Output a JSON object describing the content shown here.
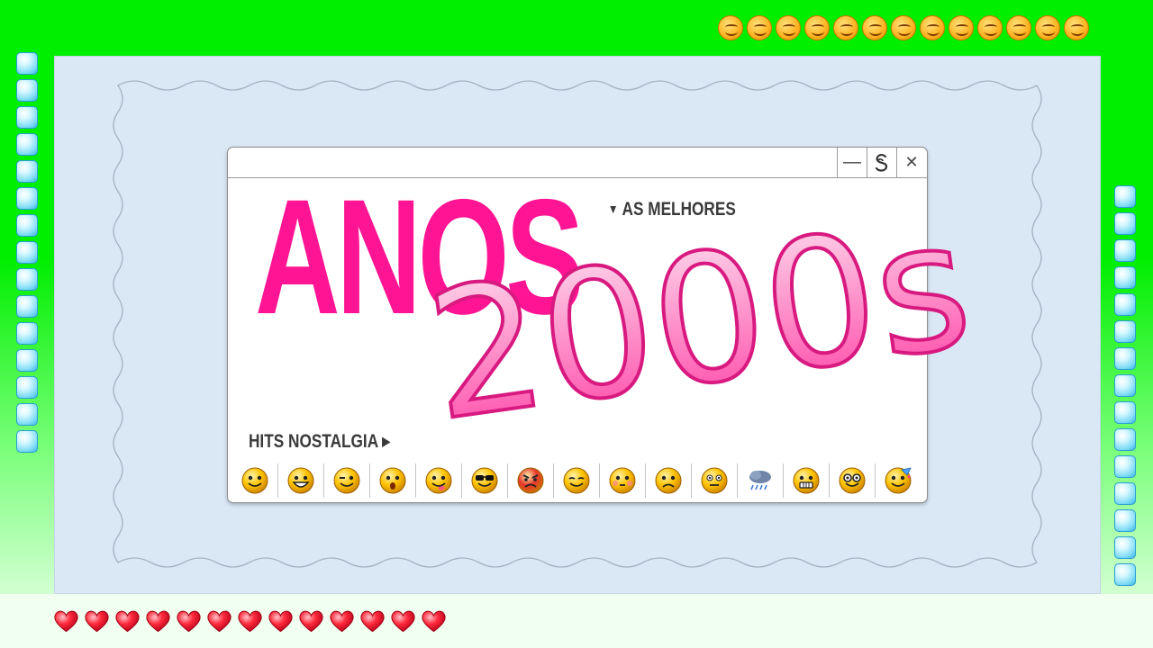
{
  "headline": {
    "word": "ANOS",
    "decade": "2000s"
  },
  "taglines": {
    "top": "AS MELHORES",
    "bottom": "HITS NOSTALGIA"
  },
  "window_controls": {
    "minimize": "—",
    "middle": "S",
    "close": "✕"
  },
  "colors": {
    "background_green": "#00ee00",
    "panel": "#dae8f6",
    "headline_pink": "#ff1493",
    "decade_gradient": [
      "#fde3f1",
      "#ff3fa4"
    ],
    "tile_blue": "#7fdcf6",
    "heart_red": "#ff2a3c"
  },
  "emoticons": [
    {
      "icon": "smile",
      "color": "#ffc400"
    },
    {
      "icon": "grin",
      "color": "#ffc400"
    },
    {
      "icon": "wink",
      "color": "#ffc400"
    },
    {
      "icon": "surprised",
      "color": "#ffc400"
    },
    {
      "icon": "tongue-out",
      "color": "#ffc400"
    },
    {
      "icon": "sunglasses",
      "color": "#ffc400"
    },
    {
      "icon": "angry",
      "color": "#e8352a"
    },
    {
      "icon": "sleepy",
      "color": "#ffc400"
    },
    {
      "icon": "blush",
      "color": "#ffc400"
    },
    {
      "icon": "sad",
      "color": "#ffc400"
    },
    {
      "icon": "neutral",
      "color": "#ffc400"
    },
    {
      "icon": "rain-cloud",
      "color": "#6f86a8"
    },
    {
      "icon": "grimace",
      "color": "#ffc400"
    },
    {
      "icon": "nerd",
      "color": "#ffc400"
    },
    {
      "icon": "party",
      "color": "#ffc400"
    }
  ],
  "decor": {
    "left_tiles_count": 15,
    "right_tiles_count": 15,
    "top_smiley_count": 13,
    "heart_count": 13
  }
}
